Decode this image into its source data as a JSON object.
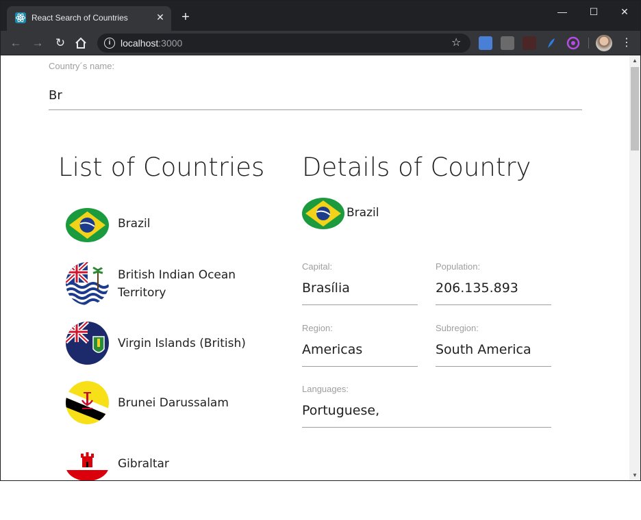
{
  "browser": {
    "tab_title": "React Search of Countries",
    "url_host": "localhost",
    "url_port": ":3000",
    "extensions": [
      "google-translate-icon",
      "extension-gray-icon",
      "pdf-icon",
      "feather-icon",
      "purple-circle-icon"
    ]
  },
  "search": {
    "label": "Country´s name:",
    "value": "Br"
  },
  "list": {
    "heading": "List of Countries",
    "countries": [
      {
        "name": "Brazil",
        "flag": "brazil-flag-icon"
      },
      {
        "name": "British Indian Ocean Territory",
        "flag": "british-indian-ocean-territory-flag-icon"
      },
      {
        "name": "Virgin Islands (British)",
        "flag": "british-virgin-islands-flag-icon"
      },
      {
        "name": "Brunei Darussalam",
        "flag": "brunei-flag-icon"
      },
      {
        "name": "Gibraltar",
        "flag": "gibraltar-flag-icon"
      }
    ]
  },
  "details": {
    "heading": "Details of Country",
    "name": "Brazil",
    "capital_label": "Capital:",
    "capital": "Brasília",
    "population_label": "Population:",
    "population": "206.135.893",
    "region_label": "Region:",
    "region": "Americas",
    "subregion_label": "Subregion:",
    "subregion": "South America",
    "languages_label": "Languages:",
    "languages": "Portuguese,"
  }
}
